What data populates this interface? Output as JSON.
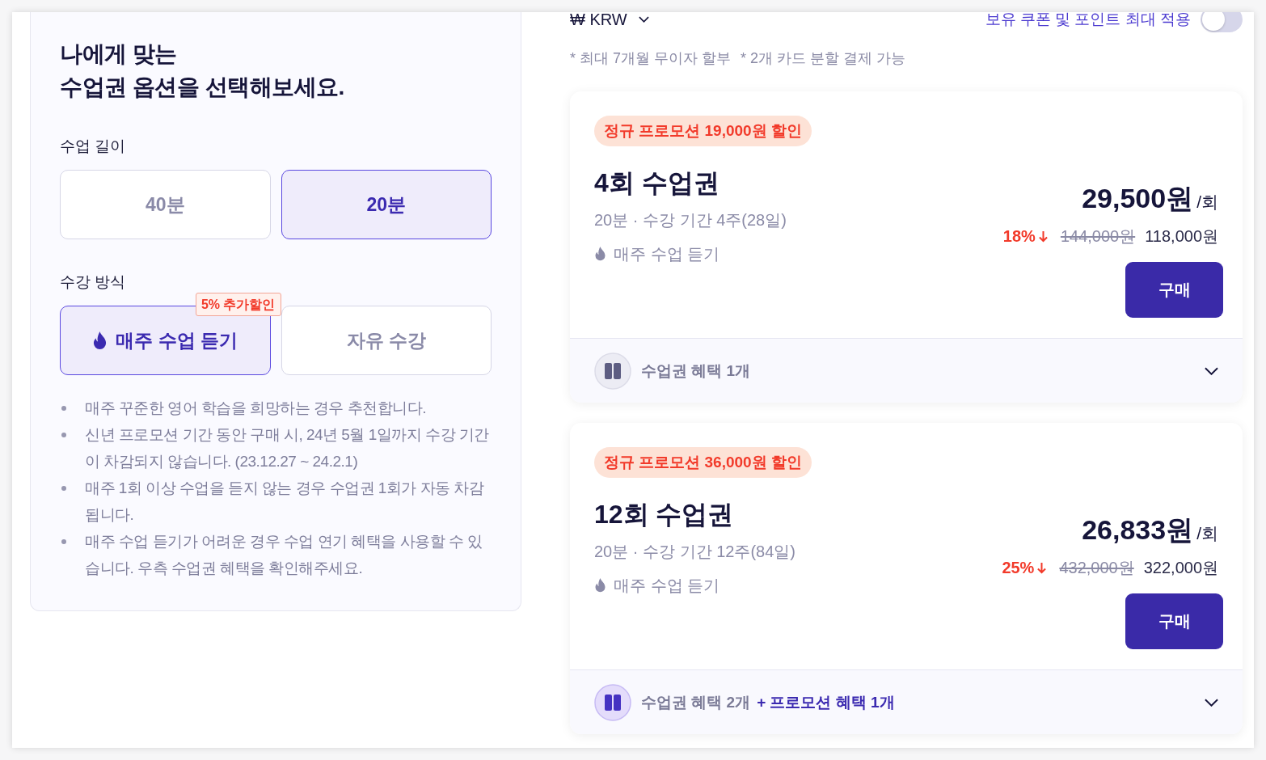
{
  "header": {
    "currency": "₩ KRW",
    "coupon_toggle": {
      "label": "보유 쿠폰 및 포인트 최대 적용",
      "on": false
    },
    "notes": [
      "* 최대 7개월 무이자 할부",
      "* 2개 카드 분할 결제 가능"
    ]
  },
  "options_panel": {
    "title": "나에게 맞는\n수업권 옵션을 선택해보세요.",
    "groups": [
      {
        "label": "수업 길이",
        "options": [
          {
            "label": "40분",
            "selected": false,
            "kind": "text"
          },
          {
            "label": "20분",
            "selected": true,
            "kind": "text"
          }
        ]
      },
      {
        "label": "수강 방식",
        "options": [
          {
            "label": "매주 수업 듣기",
            "selected": true,
            "kind": "icon",
            "badge": "5% 추가할인"
          },
          {
            "label": "자유 수강",
            "selected": false,
            "kind": "text"
          }
        ]
      }
    ],
    "notes": [
      "매주 꾸준한 영어 학습을 희망하는 경우 추천합니다.",
      "신년 프로모션 기간 동안 구매 시, 24년 5월 1일까지 수강 기간이 차감되지 않습니다. (23.12.27 ~ 24.2.1)",
      "매주 1회 이상 수업을 듣지 않는 경우 수업권 1회가 자동 차감됩니다.",
      "매주 수업 듣기가 어려운 경우 수업 연기 혜택을 사용할 수 있습니다. 우측 수업권 혜택을 확인해주세요."
    ]
  },
  "plans": [
    {
      "promo_tag": "정규 프로모션 19,000원 할인",
      "title": "4회 수업권",
      "details": "20분 · 수강 기간 4주(28일)",
      "mode": "매주 수업 듣기",
      "price": "29,500원",
      "unit": "/회",
      "discount": "18%",
      "original_price": "144,000원",
      "total": "118,000원",
      "buy_label": "구매",
      "benefits": {
        "highlighted": false,
        "label": "수업권 혜택 1개"
      }
    },
    {
      "promo_tag": "정규 프로모션 36,000원 할인",
      "title": "12회 수업권",
      "details": "20분 · 수강 기간 12주(84일)",
      "mode": "매주 수업 듣기",
      "price": "26,833원",
      "unit": "/회",
      "discount": "25%",
      "original_price": "432,000원",
      "total": "322,000원",
      "buy_label": "구매",
      "benefits": {
        "highlighted": true,
        "label": "수업권 혜택 2개",
        "promo": "+ 프로모션 혜택 1개"
      }
    }
  ]
}
